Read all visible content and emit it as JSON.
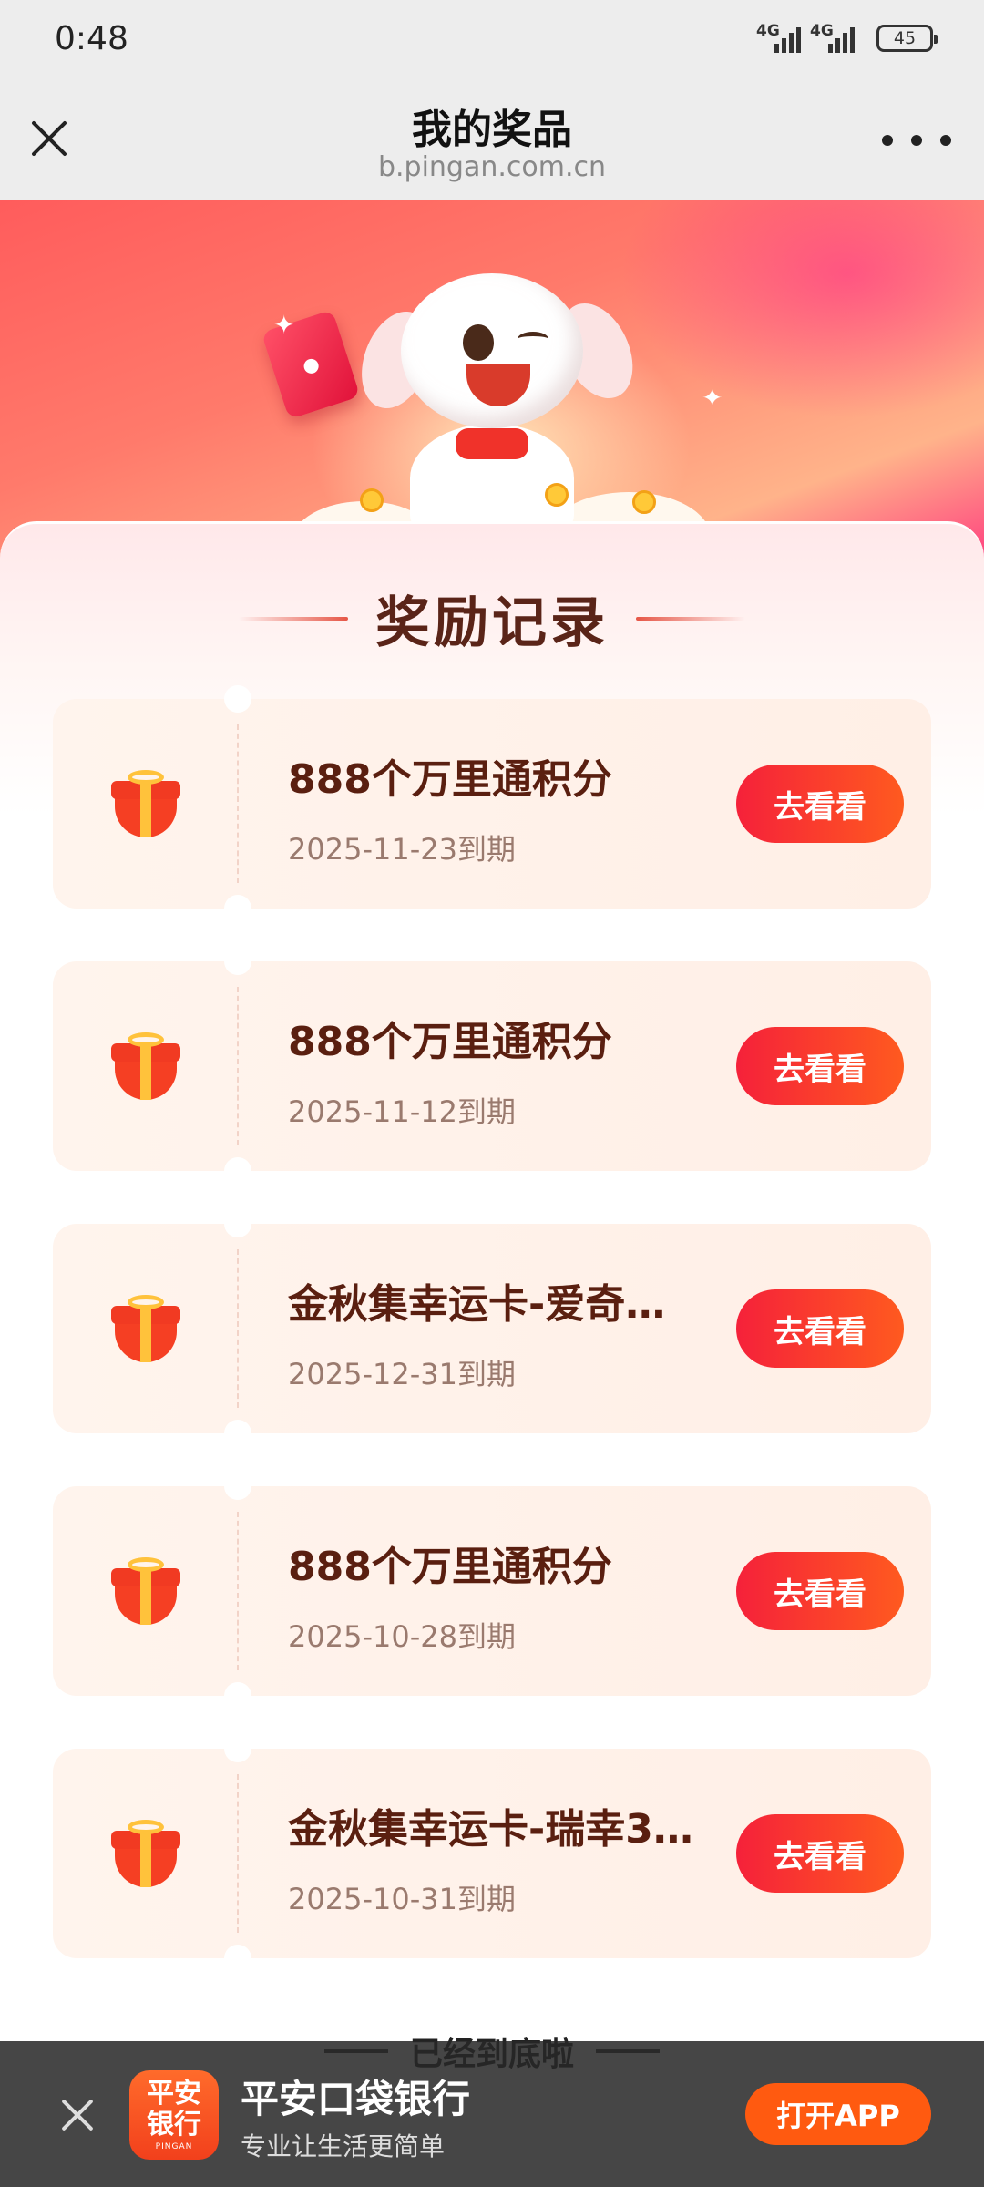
{
  "status_bar": {
    "time": "0:48",
    "network_1": "4G",
    "network_2": "4G",
    "battery": "45"
  },
  "title_bar": {
    "title": "我的奖品",
    "url": "b.pingan.com.cn"
  },
  "section": {
    "title": "奖励记录"
  },
  "rewards": [
    {
      "name": "888个万里通积分",
      "expire": "2025-11-23到期",
      "button": "去看看"
    },
    {
      "name": "888个万里通积分",
      "expire": "2025-11-12到期",
      "button": "去看看"
    },
    {
      "name": "金秋集幸运卡-爱奇…",
      "expire": "2025-12-31到期",
      "button": "去看看"
    },
    {
      "name": "888个万里通积分",
      "expire": "2025-10-28到期",
      "button": "去看看"
    },
    {
      "name": "金秋集幸运卡-瑞幸3…",
      "expire": "2025-10-31到期",
      "button": "去看看"
    }
  ],
  "footer_tip": "已经到底啦",
  "app_banner": {
    "logo_line1": "平安",
    "logo_line2": "银行",
    "logo_sub": "PINGAN",
    "name": "平安口袋银行",
    "slogan": "专业让生活更简单",
    "open_button": "打开APP"
  },
  "colors": {
    "accent": "#f5213a",
    "accent_end": "#ff5a1f",
    "reward_title": "#5a1f10",
    "open_app": "#ff5a10"
  }
}
